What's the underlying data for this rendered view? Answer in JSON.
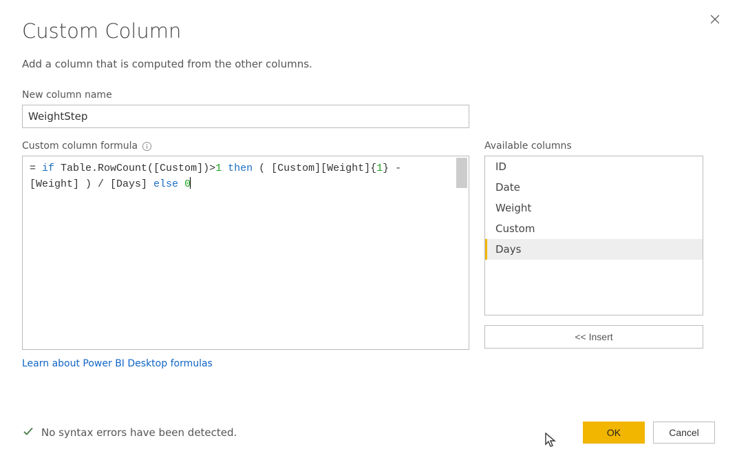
{
  "dialog": {
    "title": "Custom Column",
    "subtitle": "Add a column that is computed from the other columns."
  },
  "name_field": {
    "label": "New column name",
    "value": "WeightStep"
  },
  "formula_field": {
    "label": "Custom column formula",
    "tokens": [
      {
        "t": "= ",
        "c": ""
      },
      {
        "t": "if",
        "c": "kw"
      },
      {
        "t": " Table.RowCount([Custom])>",
        "c": ""
      },
      {
        "t": "1",
        "c": "num"
      },
      {
        "t": " ",
        "c": ""
      },
      {
        "t": "then",
        "c": "kw"
      },
      {
        "t": " ( [Custom][Weight]{",
        "c": ""
      },
      {
        "t": "1",
        "c": "num"
      },
      {
        "t": "} -",
        "c": ""
      },
      {
        "t": "\n",
        "c": "br"
      },
      {
        "t": "  [Weight] ) / [Days] ",
        "c": ""
      },
      {
        "t": "else",
        "c": "kw"
      },
      {
        "t": " ",
        "c": ""
      },
      {
        "t": "0",
        "c": "num"
      }
    ]
  },
  "available_columns": {
    "label": "Available columns",
    "items": [
      "ID",
      "Date",
      "Weight",
      "Custom",
      "Days"
    ],
    "selected_index": 4,
    "insert_label": "<< Insert"
  },
  "link": {
    "learn": "Learn about Power BI Desktop formulas"
  },
  "status": {
    "message": "No syntax errors have been detected."
  },
  "buttons": {
    "ok": "OK",
    "cancel": "Cancel"
  }
}
